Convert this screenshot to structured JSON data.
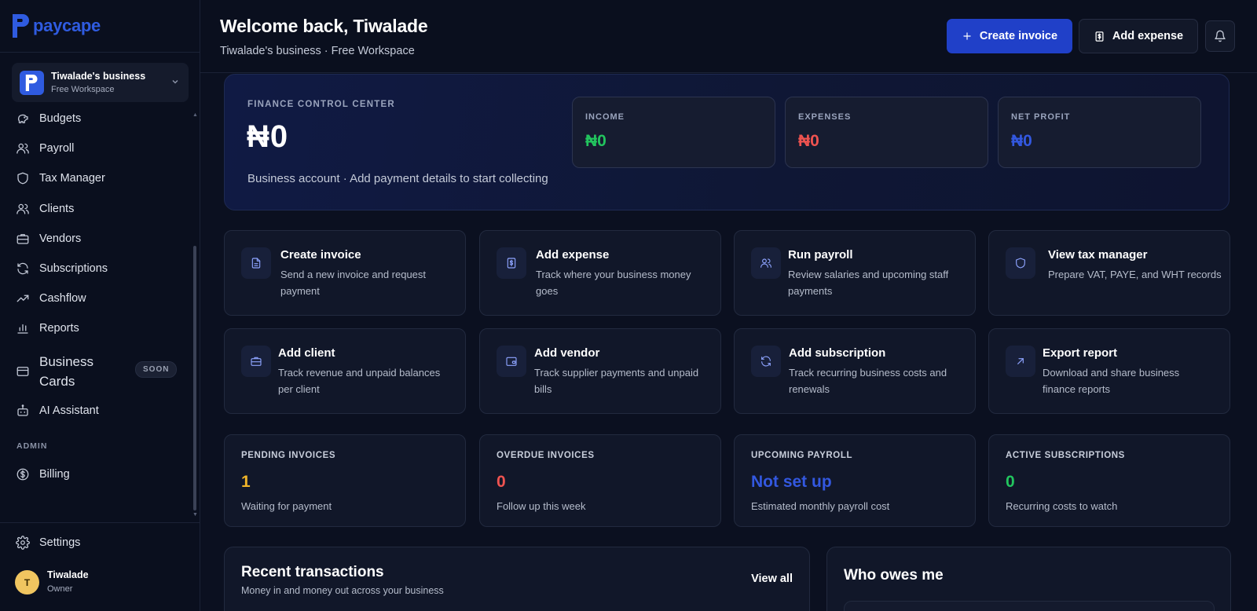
{
  "brand": {
    "name": "paycape",
    "color": "#2f5be0"
  },
  "business": {
    "name": "Tiwalade's business",
    "plan": "Free Workspace",
    "initial": "P"
  },
  "nav": {
    "budgets": "Budgets",
    "payroll": "Payroll",
    "tax_manager": "Tax Manager",
    "clients": "Clients",
    "vendors": "Vendors",
    "subscriptions": "Subscriptions",
    "cashflow": "Cashflow",
    "reports": "Reports",
    "business_cards_line1": "Business",
    "business_cards_line2": "Cards",
    "soon_badge": "SOON",
    "ai_assistant": "AI Assistant",
    "admin_label": "ADMIN",
    "billing": "Billing",
    "settings": "Settings"
  },
  "user": {
    "name": "Tiwalade",
    "role": "Owner",
    "initial": "T"
  },
  "header": {
    "welcome": "Welcome back, Tiwalade",
    "subtitle": "Tiwalade's business · Free Workspace",
    "create_invoice": "Create invoice",
    "add_expense": "Add expense"
  },
  "finance": {
    "label": "FINANCE CONTROL CENTER",
    "amount": "₦0",
    "note": "Business account · Add payment details to start collecting",
    "income_label": "INCOME",
    "income_value": "₦0",
    "expenses_label": "EXPENSES",
    "expenses_value": "₦0",
    "net_profit_label": "NET PROFIT",
    "net_profit_value": "₦0"
  },
  "actions": [
    {
      "title": "Create invoice",
      "desc_1": "Send a new invoice and request",
      "desc_2": "payment",
      "icon": "document-icon"
    },
    {
      "title": "Add expense",
      "desc_1": "Track where your business money",
      "desc_2": "goes",
      "icon": "receipt-icon"
    },
    {
      "title": "Run payroll",
      "desc_1": "Review salaries and upcoming staff",
      "desc_2": "payments",
      "icon": "users-icon"
    },
    {
      "title": "View tax manager",
      "desc_1": "Prepare VAT, PAYE, and WHT records",
      "desc_2": "",
      "icon": "shield-icon"
    },
    {
      "title": "Add client",
      "desc_1": "Track revenue and unpaid balances",
      "desc_2": "per client",
      "icon": "briefcase-icon"
    },
    {
      "title": "Add vendor",
      "desc_1": "Track supplier payments and unpaid",
      "desc_2": "bills",
      "icon": "wallet-icon"
    },
    {
      "title": "Add subscription",
      "desc_1": "Track recurring business costs and",
      "desc_2": "renewals",
      "icon": "refresh-icon"
    },
    {
      "title": "Export report",
      "desc_1": "Download and share business",
      "desc_2": "finance reports",
      "icon": "arrow-up-right-icon"
    }
  ],
  "metrics": [
    {
      "label": "PENDING INVOICES",
      "value": "1",
      "desc": "Waiting for payment",
      "color": "#f0b429"
    },
    {
      "label": "OVERDUE INVOICES",
      "value": "0",
      "desc": "Follow up this week",
      "color": "#ef5350"
    },
    {
      "label": "UPCOMING PAYROLL",
      "value": "Not set up",
      "desc": "Estimated monthly payroll cost",
      "color": "#3358e0"
    },
    {
      "label": "ACTIVE SUBSCRIPTIONS",
      "value": "0",
      "desc": "Recurring costs to watch",
      "color": "#22c55e"
    }
  ],
  "recent": {
    "title": "Recent transactions",
    "subtitle": "Money in and money out across your business",
    "view_all": "View all"
  },
  "owes": {
    "title": "Who owes me"
  },
  "colors": {
    "income": "#22c55e",
    "expenses": "#ef5350",
    "net_profit": "#3358e0",
    "primary_button": "#2040c8"
  }
}
